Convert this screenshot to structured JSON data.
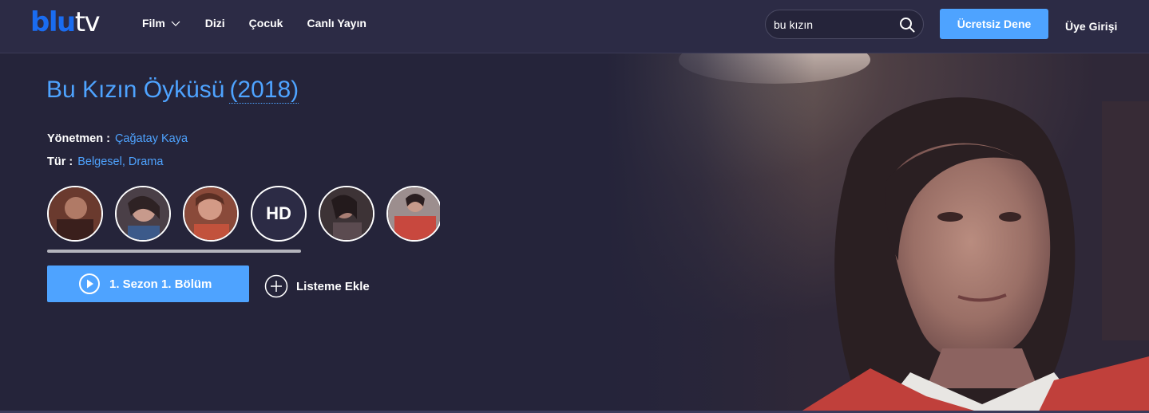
{
  "header": {
    "logo": {
      "part1": "blu",
      "part2": "tv"
    },
    "nav": [
      {
        "label": "Film",
        "has_dropdown": true
      },
      {
        "label": "Dizi"
      },
      {
        "label": "Çocuk"
      },
      {
        "label": "Canlı Yayın"
      }
    ],
    "search": {
      "value": "bu kızın",
      "placeholder": ""
    },
    "trial_button": "Ücretsiz Dene",
    "login": "Üye Girişi"
  },
  "title": {
    "name": "Bu Kızın Öyküsü",
    "year": "(2018)"
  },
  "details": {
    "director_label": "Yönetmen :",
    "director": "Çağatay Kaya",
    "genre_label": "Tür :",
    "genre": "Belgesel, Drama"
  },
  "thumbnails": [
    {
      "kind": "image"
    },
    {
      "kind": "image"
    },
    {
      "kind": "image"
    },
    {
      "kind": "badge",
      "label": "HD"
    },
    {
      "kind": "image"
    },
    {
      "kind": "image"
    }
  ],
  "actions": {
    "play": "1. Sezon 1. Bölüm",
    "add_to_list": "Listeme Ekle"
  },
  "colors": {
    "accent": "#4ea3ff",
    "logo_blue": "#1a6cf0",
    "header_bg": "#2c2b45",
    "page_bg": "#25243a"
  },
  "icons": [
    "chevron-down-icon",
    "search-icon",
    "play-icon",
    "plus-icon"
  ]
}
